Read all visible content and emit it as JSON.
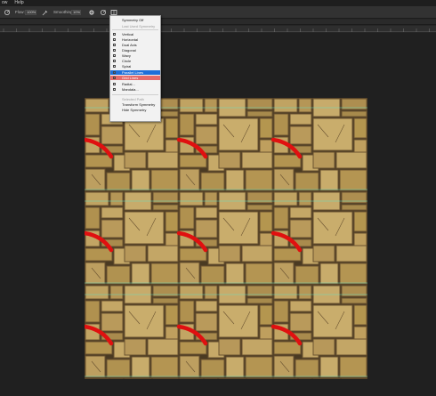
{
  "menubar": {
    "items": [
      "ow",
      "Help"
    ]
  },
  "toolbar": {
    "flow_label": "Flow:",
    "flow_value": "100%",
    "smoothing_label": "Smoothing:",
    "smoothing_value": "10%"
  },
  "symmetry_menu": {
    "items": [
      {
        "label": "Symmetry Off",
        "disabled": false,
        "icon": ""
      },
      {
        "label": "Last Used Symmetry",
        "disabled": true,
        "icon": ""
      },
      {
        "label": "Vertical",
        "disabled": false,
        "icon": "vertical-icon"
      },
      {
        "label": "Horizontal",
        "disabled": false,
        "icon": "horizontal-icon"
      },
      {
        "label": "Dual Axis",
        "disabled": false,
        "icon": "dual-axis-icon"
      },
      {
        "label": "Diagonal",
        "disabled": false,
        "icon": "diagonal-icon"
      },
      {
        "label": "Wavy",
        "disabled": false,
        "icon": "wavy-icon"
      },
      {
        "label": "Circle",
        "disabled": false,
        "icon": "circle-icon"
      },
      {
        "label": "Spiral",
        "disabled": false,
        "icon": "spiral-icon"
      },
      {
        "label": "Parallel Lines",
        "disabled": false,
        "icon": "parallel-lines-icon",
        "state": "highlighted"
      },
      {
        "label": "Grid Lines",
        "disabled": false,
        "icon": "grid-lines-icon",
        "state": "hover"
      },
      {
        "label": "Radial...",
        "disabled": false,
        "icon": "radial-icon"
      },
      {
        "label": "Mandala...",
        "disabled": false,
        "icon": "mandala-icon"
      },
      {
        "label": "Selected Path",
        "disabled": true,
        "icon": ""
      },
      {
        "label": "Transform Symmetry",
        "disabled": false,
        "icon": ""
      },
      {
        "label": "Hide Symmetry",
        "disabled": false,
        "icon": ""
      }
    ]
  },
  "colors": {
    "menu_highlight": "#1e6fd9",
    "menu_hover": "#e46b6b",
    "stone_base": "#b89a5a",
    "guide_line": "#5fe3c8",
    "stroke": "#e01010"
  }
}
